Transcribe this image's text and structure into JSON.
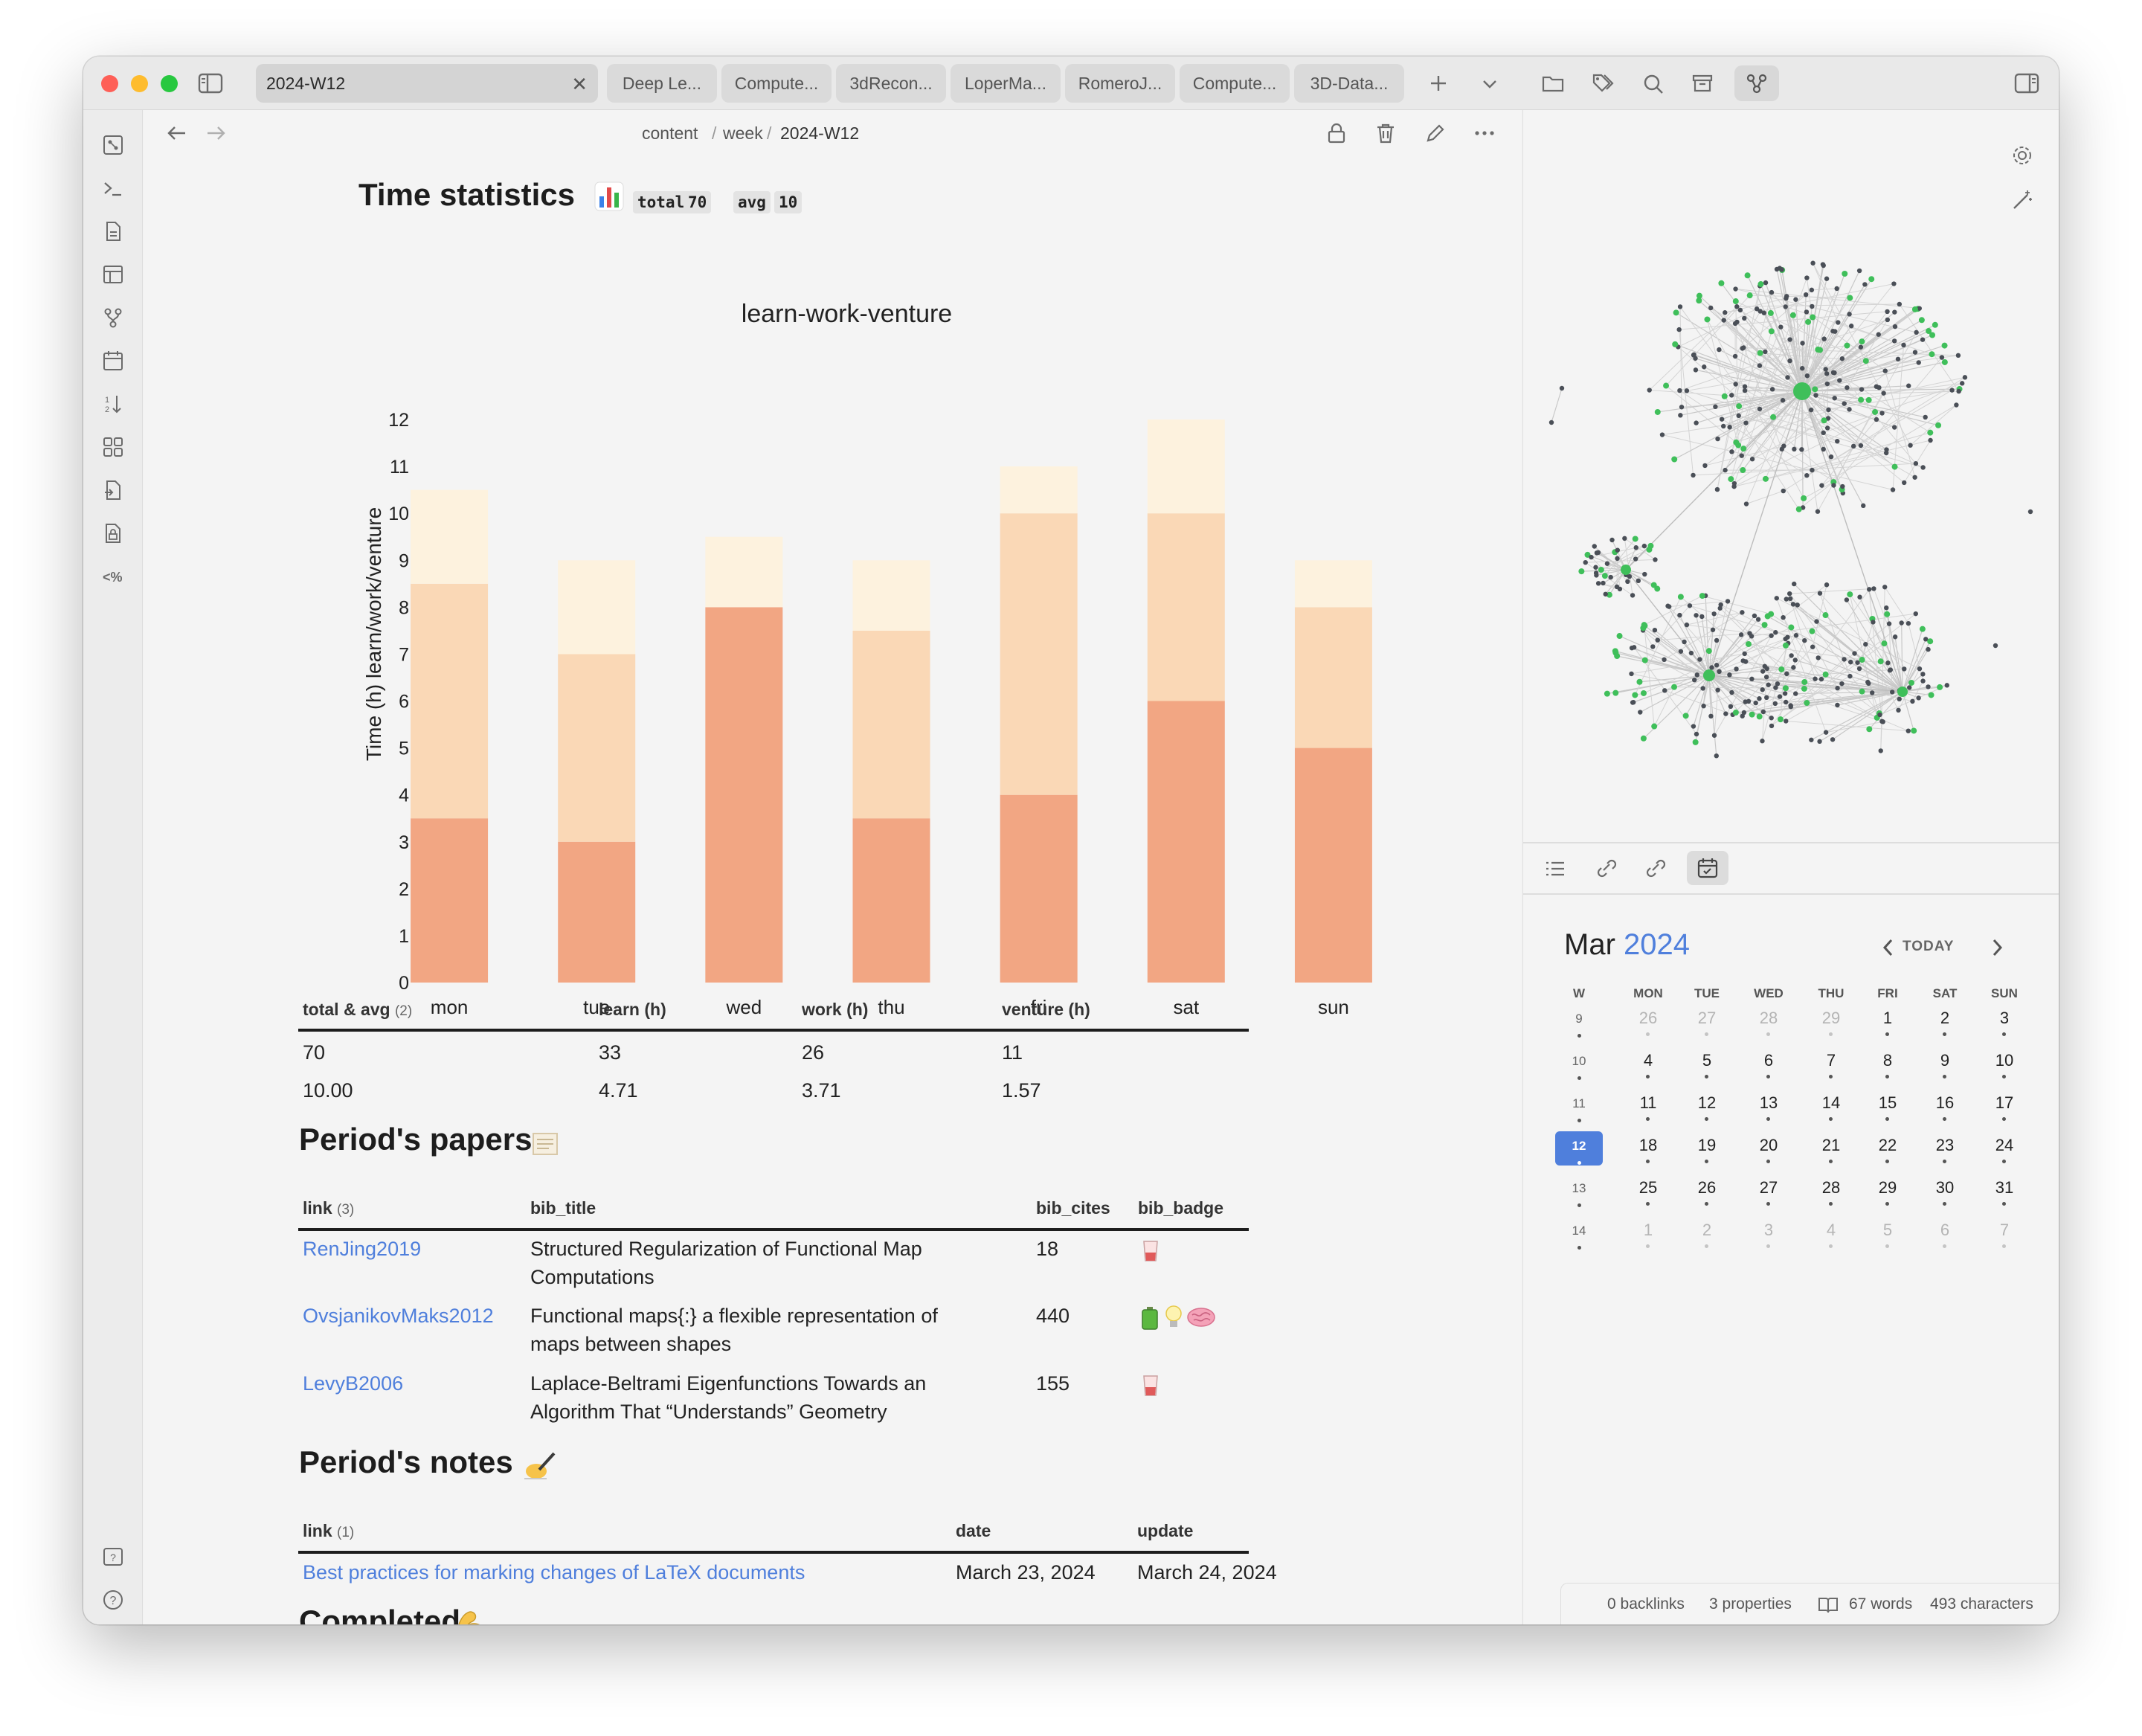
{
  "tabs": [
    {
      "label": "2024-W12",
      "active": true
    },
    {
      "label": "Deep Le..."
    },
    {
      "label": "Compute..."
    },
    {
      "label": "3dRecon..."
    },
    {
      "label": "LoperMa..."
    },
    {
      "label": "RomeroJ..."
    },
    {
      "label": "Compute..."
    },
    {
      "label": "3D-Data..."
    }
  ],
  "breadcrumb": {
    "part1": "content",
    "sep": "/",
    "part2": "week",
    "part3": "2024-W12"
  },
  "time_stats": {
    "heading": "Time statistics",
    "total_label": "total",
    "total_value": "70",
    "avg_label": "avg",
    "avg_value": "10"
  },
  "chart_data": {
    "type": "bar",
    "stacked": true,
    "title": "learn-work-venture",
    "ylabel": "Time (h) learn/work/venture",
    "xlabel": "",
    "categories": [
      "mon",
      "tue",
      "wed",
      "thu",
      "fri",
      "sat",
      "sun"
    ],
    "ylim": [
      0,
      12
    ],
    "yticks": [
      0,
      1,
      2,
      3,
      4,
      5,
      6,
      7,
      8,
      9,
      10,
      11,
      12
    ],
    "series": [
      {
        "values": [
          3.5,
          3,
          8,
          3.5,
          4,
          6,
          5
        ],
        "color": "#f2a683"
      },
      {
        "values": [
          5,
          4,
          0,
          4,
          6,
          4,
          3
        ],
        "color": "#fad8b6"
      },
      {
        "values": [
          2,
          2,
          1.5,
          1.5,
          1,
          2,
          1
        ],
        "color": "#fdf2de"
      }
    ],
    "grid": false,
    "legend": "none"
  },
  "summary_table": {
    "headers": [
      "total & avg",
      "learn (h)",
      "work (h)",
      "venture (h)"
    ],
    "count": "(2)",
    "rows": [
      [
        "70",
        "33",
        "26",
        "11"
      ],
      [
        "10.00",
        "4.71",
        "3.71",
        "1.57"
      ]
    ]
  },
  "papers": {
    "heading": "Period's papers",
    "headers": [
      "link",
      "bib_title",
      "bib_cites",
      "bib_badge"
    ],
    "count": "(3)",
    "rows": [
      {
        "link": "RenJing2019",
        "title1": "Structured Regularization of Functional Map",
        "title2": "Computations",
        "cites": "18",
        "badges": [
          "glass"
        ]
      },
      {
        "link": "OvsjanikovMaks2012",
        "title1": "Functional maps{:} a flexible representation of",
        "title2": "maps between shapes",
        "cites": "440",
        "badges": [
          "battery",
          "bulb",
          "brain"
        ]
      },
      {
        "link": "LevyB2006",
        "title1": "Laplace-Beltrami Eigenfunctions Towards an",
        "title2": "Algorithm That “Understands” Geometry",
        "cites": "155",
        "badges": [
          "glass"
        ]
      }
    ]
  },
  "notes": {
    "heading": "Period's notes",
    "headers": [
      "link",
      "date",
      "update"
    ],
    "count": "(1)",
    "rows": [
      {
        "link": "Best practices for marking changes of LaTeX documents",
        "date": "March 23, 2024",
        "update": "March 24, 2024"
      }
    ]
  },
  "completed": {
    "heading": "Completed"
  },
  "calendar": {
    "month": "Mar",
    "year": "2024",
    "today_label": "TODAY",
    "weekday_headers": [
      "W",
      "MON",
      "TUE",
      "WED",
      "THU",
      "FRI",
      "SAT",
      "SUN"
    ],
    "weeks": [
      {
        "w": "9",
        "days": [
          "26",
          "27",
          "28",
          "29",
          "1",
          "2",
          "3"
        ]
      },
      {
        "w": "10",
        "days": [
          "4",
          "5",
          "6",
          "7",
          "8",
          "9",
          "10"
        ]
      },
      {
        "w": "11",
        "days": [
          "11",
          "12",
          "13",
          "14",
          "15",
          "16",
          "17"
        ]
      },
      {
        "w": "12",
        "days": [
          "18",
          "19",
          "20",
          "21",
          "22",
          "23",
          "24"
        ],
        "selected": true
      },
      {
        "w": "13",
        "days": [
          "25",
          "26",
          "27",
          "28",
          "29",
          "30",
          "31"
        ]
      },
      {
        "w": "14",
        "days": [
          "1",
          "2",
          "3",
          "4",
          "5",
          "6",
          "7"
        ]
      }
    ]
  },
  "status_bar": {
    "backlinks": "0 backlinks",
    "properties": "3 properties",
    "words": "67 words",
    "characters": "493 characters"
  },
  "icons": {
    "ribbon": [
      "graph-view-icon",
      "terminal-icon",
      "file-icon",
      "table-icon",
      "git-fork-icon",
      "calendar-icon",
      "sort-icon",
      "dashboard-icon",
      "file-export-icon",
      "lock-file-icon",
      "template-icon"
    ],
    "accent": "#4f7fdc",
    "graph_green": "#3fbf5a",
    "graph_gray": "#4a4f57"
  }
}
